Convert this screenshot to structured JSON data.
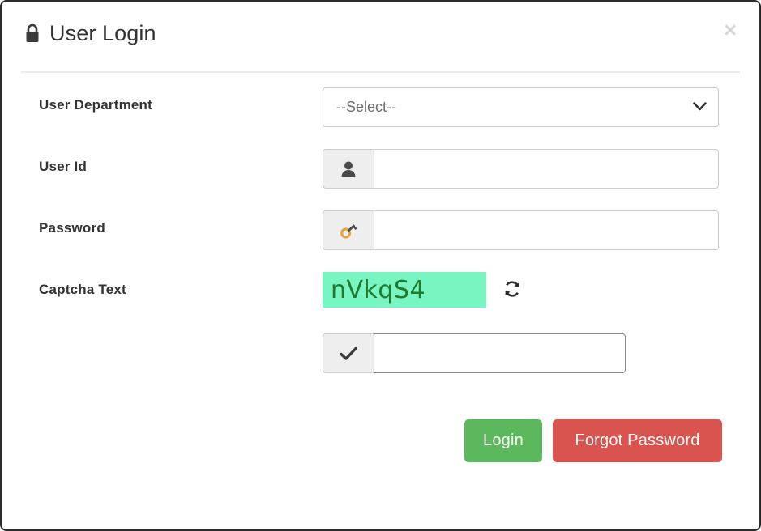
{
  "dialog": {
    "title": "User Login",
    "title_icon": "lock-icon",
    "close_label": "×"
  },
  "form": {
    "department": {
      "label": "User Department",
      "selected_value": "--Select--",
      "dropdown_icon": "chevron-down-icon"
    },
    "user_id": {
      "label": "User Id",
      "value": "",
      "placeholder": "",
      "addon_icon": "user-icon"
    },
    "password": {
      "label": "Password",
      "value": "",
      "placeholder": "",
      "addon_icon": "key-icon"
    },
    "captcha": {
      "label": "Captcha Text",
      "code": "nVkqS4",
      "refresh_icon": "refresh-icon",
      "answer_value": "",
      "answer_placeholder": "",
      "answer_addon_icon": "check-icon"
    }
  },
  "footer": {
    "login_label": "Login",
    "forgot_password_label": "Forgot Password"
  },
  "colors": {
    "login_button": "#5cb85c",
    "forgot_button": "#d9534f",
    "captcha_background": "#78f5c0",
    "captcha_text": "#1f7a2e",
    "addon_background": "#eeeeee",
    "border": "#cccccc"
  }
}
